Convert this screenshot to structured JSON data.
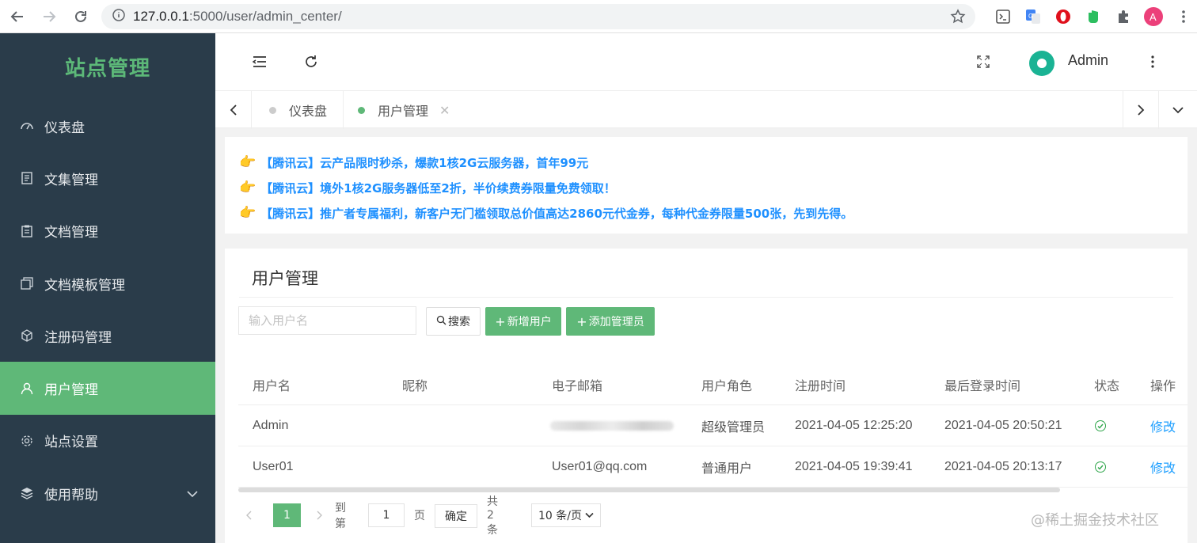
{
  "browser": {
    "url_host": "127.0.0.1",
    "url_path": ":5000/user/admin_center/"
  },
  "sidebar": {
    "brand": "站点管理",
    "items": [
      {
        "label": "仪表盘",
        "icon": "dashboard-icon"
      },
      {
        "label": "文集管理",
        "icon": "document-icon"
      },
      {
        "label": "文档管理",
        "icon": "clipboard-icon"
      },
      {
        "label": "文档模板管理",
        "icon": "template-icon"
      },
      {
        "label": "注册码管理",
        "icon": "cube-icon"
      },
      {
        "label": "用户管理",
        "icon": "user-icon",
        "active": true
      },
      {
        "label": "站点设置",
        "icon": "gear-icon"
      },
      {
        "label": "使用帮助",
        "icon": "layers-icon"
      }
    ]
  },
  "header": {
    "user_name": "Admin"
  },
  "tabs": [
    {
      "label": "仪表盘",
      "active": false
    },
    {
      "label": "用户管理",
      "active": true
    }
  ],
  "notice": {
    "lines": [
      "【腾讯云】云产品限时秒杀，爆款1核2G云服务器，首年99元",
      "【腾讯云】境外1核2G服务器低至2折，半价续费券限量免费领取！",
      "【腾讯云】推广者专属福利，新客户无门槛领取总价值高达2860元代金券，每种代金券限量500张，先到先得。"
    ]
  },
  "main": {
    "title": "用户管理",
    "search_placeholder": "输入用户名",
    "search_button": "搜索",
    "add_user_button": "新增用户",
    "add_admin_button": "添加管理员",
    "columns": [
      "用户名",
      "昵称",
      "电子邮箱",
      "用户角色",
      "注册时间",
      "最后登录时间",
      "状态",
      "操作"
    ],
    "rows": [
      {
        "username": "Admin",
        "nickname": "",
        "email": "",
        "role": "超级管理员",
        "registered": "2021-04-05 12:25:20",
        "last_login": "2021-04-05 20:50:21",
        "action": "修改"
      },
      {
        "username": "User01",
        "nickname": "",
        "email": "User01@qq.com",
        "role": "普通用户",
        "registered": "2021-04-05 19:39:41",
        "last_login": "2021-04-05 20:13:17",
        "action": "修改"
      }
    ]
  },
  "pagination": {
    "current_page": "1",
    "goto_label": "到第",
    "goto_value": "1",
    "page_label": "页",
    "confirm": "确定",
    "total": "共 2 条",
    "per_page": "10 条/页"
  },
  "watermark": "@稀土掘金技术社区",
  "colors": {
    "sidebar_bg": "#2a3c4a",
    "accent_green": "#5fb878",
    "link_blue": "#1e9fff",
    "notice_blue": "#1e90ff"
  }
}
